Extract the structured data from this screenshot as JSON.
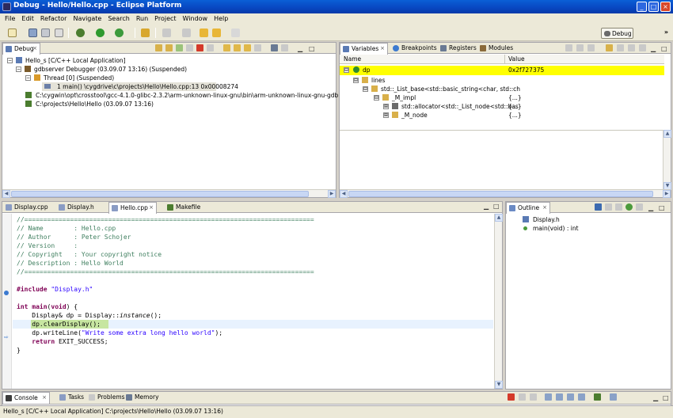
{
  "window": {
    "title": "Debug - Hello/Hello.cpp - Eclipse Platform",
    "minimize": "_",
    "maximize": "□",
    "close": "×"
  },
  "menu": [
    "File",
    "Edit",
    "Refactor",
    "Navigate",
    "Search",
    "Run",
    "Project",
    "Window",
    "Help"
  ],
  "perspective": {
    "label": "Debug",
    "overflow": "»"
  },
  "debug_view": {
    "tab": "Debug",
    "tree": [
      {
        "label": "Hello_s [C/C++ Local Application]",
        "level": 0
      },
      {
        "label": "gdbserver Debugger (03.09.07 13:16) (Suspended)",
        "level": 1
      },
      {
        "label": "Thread [0] (Suspended)",
        "level": 2
      },
      {
        "label": "1 main() \\cygdrive\\c\\projects\\Hello\\Hello.cpp:13 0x00008274",
        "level": 3
      },
      {
        "label": "C:\\cygwin\\opt\\crosstool\\gcc-4.1.0-glibc-2.3.2\\arm-unknown-linux-gnu\\bin\\arm-unknown-linux-gnu-gdb.exe (03.09.07",
        "level": 1
      },
      {
        "label": "C:\\projects\\Hello\\Hello (03.09.07 13:16)",
        "level": 1
      }
    ]
  },
  "variables_view": {
    "tabs": [
      "Variables",
      "Breakpoints",
      "Registers",
      "Modules"
    ],
    "columns": [
      "Name",
      "Value"
    ],
    "rows": [
      {
        "name": "dp",
        "value": "0x2f727375",
        "expander": "⊟"
      },
      {
        "name": "lines",
        "value": "",
        "expander": "⊟"
      },
      {
        "name": "std::_List_base<std::basic_string<char, std::ch",
        "value": "",
        "expander": "⊟"
      },
      {
        "name": "_M_impl",
        "value": "{...}",
        "expander": "⊟"
      },
      {
        "name": "std::allocator<std::_List_node<std::bas",
        "value": "{...}",
        "expander": "⊞"
      },
      {
        "name": "_M_node",
        "value": "{...}",
        "expander": "⊞"
      }
    ]
  },
  "editor": {
    "tabs": [
      "Display.cpp",
      "Display.h",
      "Hello.cpp",
      "Makefile"
    ],
    "lines": [
      [
        {
          "t": "//============================================================================",
          "c": "comment"
        }
      ],
      [
        {
          "t": "// Name        : Hello.cpp",
          "c": "comment"
        }
      ],
      [
        {
          "t": "// Author      : Peter Schojer",
          "c": "comment"
        }
      ],
      [
        {
          "t": "// Version     :",
          "c": "comment"
        }
      ],
      [
        {
          "t": "// Copyright   : Your copyright notice",
          "c": "comment"
        }
      ],
      [
        {
          "t": "// Description : Hello World",
          "c": "comment"
        }
      ],
      [
        {
          "t": "//============================================================================",
          "c": "comment"
        }
      ],
      [
        {
          "t": "",
          "c": "plain"
        }
      ],
      [
        {
          "t": "#include ",
          "c": "pre"
        },
        {
          "t": "\"Display.h\"",
          "c": "str"
        }
      ],
      [
        {
          "t": "",
          "c": "plain"
        }
      ],
      [
        {
          "t": "int",
          "c": "kw"
        },
        {
          "t": " ",
          "c": "plain"
        },
        {
          "t": "main",
          "c": "kw"
        },
        {
          "t": "(",
          "c": "plain"
        },
        {
          "t": "void",
          "c": "kw"
        },
        {
          "t": ") {",
          "c": "plain"
        }
      ],
      [
        {
          "t": "    Display& dp = Display::",
          "c": "plain"
        },
        {
          "t": "instance",
          "c": "static"
        },
        {
          "t": "();",
          "c": "plain"
        }
      ],
      [
        {
          "t": "    dp.clearDisplay();",
          "c": "plain"
        }
      ],
      [
        {
          "t": "    dp.writeLine(",
          "c": "plain"
        },
        {
          "t": "\"Write some extra long hello world\"",
          "c": "str"
        },
        {
          "t": ");",
          "c": "plain"
        }
      ],
      [
        {
          "t": "    ",
          "c": "plain"
        },
        {
          "t": "return",
          "c": "kw"
        },
        {
          "t": " EXIT_SUCCESS;",
          "c": "plain"
        }
      ],
      [
        {
          "t": "}",
          "c": "plain"
        }
      ]
    ]
  },
  "outline_view": {
    "tab": "Outline",
    "items": [
      "Display.h",
      "main(void) : int"
    ]
  },
  "console_view": {
    "tabs": [
      "Console",
      "Tasks",
      "Problems",
      "Memory"
    ],
    "status": "Hello_s [C/C++ Local Application] C:\\projects\\Hello\\Hello (03.09.07 13:16)"
  },
  "colors": {
    "highlight": "#ffff00",
    "current_line": "#c7e6a1",
    "caret_line": "#e8f2fe"
  }
}
